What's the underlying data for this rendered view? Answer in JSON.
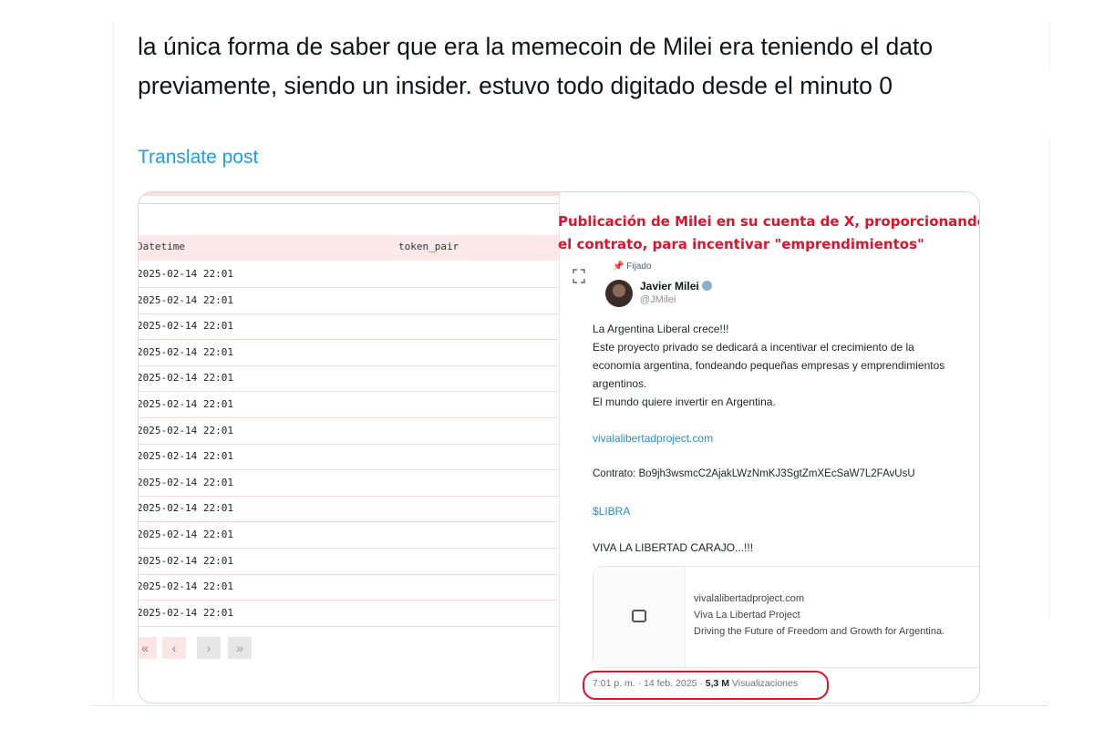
{
  "post": {
    "text": "la única forma de saber que era la memecoin de Milei era teniendo el dato previamente, siendo un insider. estuvo todo digitado desde el minuto 0",
    "translate_label": "Translate post"
  },
  "table": {
    "headers": [
      "Datetime",
      "token_pair"
    ],
    "rows": [
      "2025-02-14 22:01",
      "2025-02-14 22:01",
      "2025-02-14 22:01",
      "2025-02-14 22:01",
      "2025-02-14 22:01",
      "2025-02-14 22:01",
      "2025-02-14 22:01",
      "2025-02-14 22:01",
      "2025-02-14 22:01",
      "2025-02-14 22:01",
      "2025-02-14 22:01",
      "2025-02-14 22:01",
      "2025-02-14 22:01",
      "2025-02-14 22:01"
    ],
    "pager": [
      "«",
      "‹",
      "›",
      "»"
    ]
  },
  "screenshot": {
    "caption_line1": "Publicación de Milei en su cuenta de X, proporcionando",
    "caption_line2": "el contrato, para incentivar \"emprendimientos\"",
    "pinned": "Fijado",
    "name": "Javier Milei",
    "handle": "@JMilei",
    "lines": [
      "La Argentina Liberal crece!!!",
      "Este proyecto privado se dedicará a incentivar el crecimiento de la",
      "economía argentina, fondeando pequeñas empresas y emprendimientos",
      "argentinos.",
      "El mundo quiere invertir en Argentina."
    ],
    "link": "vivalalibertadproject.com",
    "contract": "Contrato: Bo9jh3wsmcC2AjakLWzNmKJ3SgtZmXEcSaW7L2FAvUsU",
    "cashtag": "$LIBRA",
    "closing": "VIVA LA LIBERTAD CARAJO...!!!",
    "card_domain": "vivalalibertadproject.com",
    "card_title": "Viva La Libertad Project",
    "card_desc": "Driving the Future of Freedom and Growth for Argentina.",
    "meta_time": "7:01 p. m. · 14 feb. 2025 · ",
    "meta_views": "5,3 M",
    "meta_views_label": " Visualizaciones"
  },
  "colors": {
    "link": "#1d9bf0",
    "highlight": "#e3122a"
  }
}
